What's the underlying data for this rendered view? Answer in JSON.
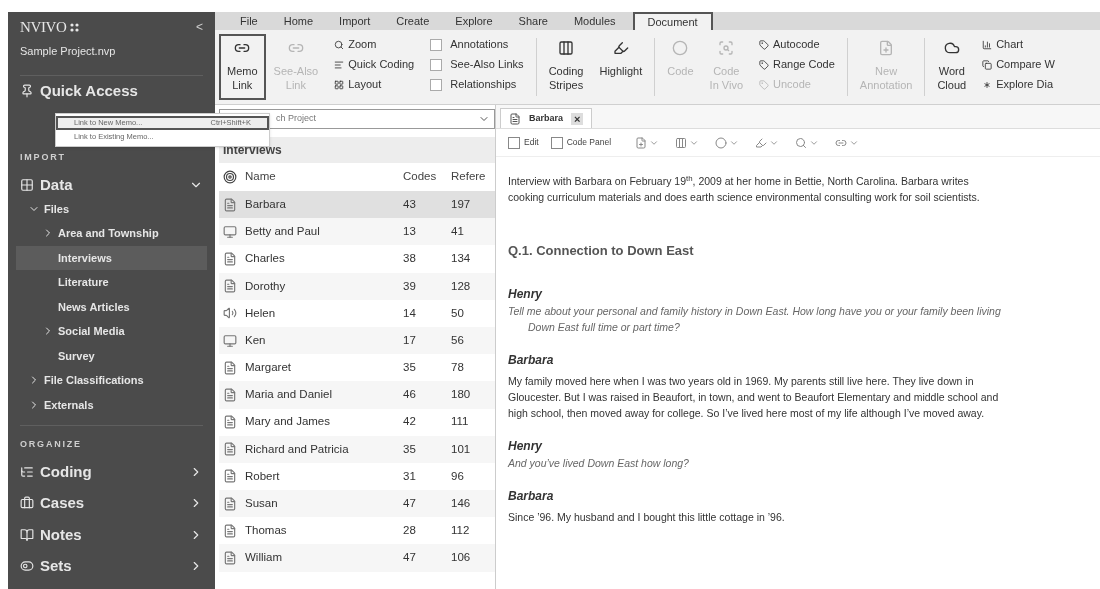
{
  "sidebar": {
    "logo": "NVIVO",
    "collapse": "<",
    "project": "Sample Project.nvp",
    "quick_access": "Quick Access",
    "sections": [
      {
        "title": "IMPORT",
        "items": [
          {
            "label": "Data",
            "expanded": true,
            "children": [
              {
                "label": "Files",
                "expanded": true,
                "children": [
                  {
                    "label": "Area and Township",
                    "expandable": true,
                    "selected": false
                  },
                  {
                    "label": "Interviews",
                    "expandable": false,
                    "selected": true
                  },
                  {
                    "label": "Literature",
                    "expandable": false,
                    "selected": false
                  },
                  {
                    "label": "News Articles",
                    "expandable": false,
                    "selected": false
                  },
                  {
                    "label": "Social Media",
                    "expandable": true,
                    "selected": false
                  },
                  {
                    "label": "Survey",
                    "expandable": false,
                    "selected": false
                  }
                ]
              },
              {
                "label": "File Classifications",
                "expanded": false
              },
              {
                "label": "Externals",
                "expanded": false
              }
            ]
          }
        ]
      },
      {
        "title": "ORGANIZE",
        "items": [
          {
            "label": "Coding",
            "expanded": false
          },
          {
            "label": "Cases",
            "expanded": false
          },
          {
            "label": "Notes",
            "expanded": false
          },
          {
            "label": "Sets",
            "expanded": false
          }
        ]
      }
    ]
  },
  "ribbon": {
    "tabs": [
      {
        "label": "File",
        "selected": false
      },
      {
        "label": "Home",
        "selected": false
      },
      {
        "label": "Import",
        "selected": false
      },
      {
        "label": "Create",
        "selected": false
      },
      {
        "label": "Explore",
        "selected": false
      },
      {
        "label": "Share",
        "selected": false
      },
      {
        "label": "Modules",
        "selected": false
      },
      {
        "label": "Document",
        "selected": true
      }
    ],
    "groups": [
      {
        "kind": "large",
        "label": "Memo\nLink",
        "disabled": false,
        "selected": true
      },
      {
        "kind": "large",
        "label": "See-Also\nLink",
        "disabled": true,
        "selected": false
      },
      {
        "kind": "stack",
        "items": [
          {
            "label": "Zoom",
            "disabled": false
          },
          {
            "label": "Quick Coding",
            "disabled": false
          },
          {
            "label": "Layout",
            "disabled": false
          }
        ]
      },
      {
        "kind": "checks",
        "items": [
          {
            "label": "Annotations",
            "checked": false
          },
          {
            "label": "See-Also Links",
            "checked": false
          },
          {
            "label": "Relationships",
            "checked": false
          }
        ]
      },
      {
        "kind": "large",
        "label": "Coding\nStripes",
        "disabled": false,
        "selected": false
      },
      {
        "kind": "large",
        "label": "Highlight",
        "disabled": false,
        "selected": false
      },
      {
        "kind": "large",
        "label": "Code",
        "disabled": true,
        "selected": false
      },
      {
        "kind": "large",
        "label": "Code\nIn Vivo",
        "disabled": true,
        "selected": false
      },
      {
        "kind": "stack",
        "items": [
          {
            "label": "Autocode",
            "disabled": false
          },
          {
            "label": "Range Code",
            "disabled": false
          },
          {
            "label": "Uncode",
            "disabled": true
          }
        ]
      },
      {
        "kind": "large",
        "label": "New\nAnnotation",
        "disabled": true,
        "selected": false
      },
      {
        "kind": "large",
        "label": "Word\nCloud",
        "disabled": false,
        "selected": false
      },
      {
        "kind": "stack",
        "items": [
          {
            "label": "Chart",
            "disabled": false
          },
          {
            "label": "Compare W",
            "disabled": false
          },
          {
            "label": "Explore Dia",
            "disabled": false
          }
        ]
      }
    ]
  },
  "menu": {
    "items": [
      {
        "label": "Link to New Memo...",
        "shortcut": "Ctrl+Shift+K",
        "selected": true
      },
      {
        "label": "Link to Existing Memo...",
        "selected": false
      }
    ]
  },
  "list": {
    "search": {
      "placeholder": "ch Project"
    },
    "title": "Interviews",
    "columns": [
      "Name",
      "Codes",
      "Refere"
    ],
    "rows": [
      {
        "kind": "document",
        "name": "Barbara",
        "codes": "43",
        "refs": "197",
        "selected": true
      },
      {
        "kind": "video",
        "name": "Betty and Paul",
        "codes": "13",
        "refs": "41",
        "selected": false
      },
      {
        "kind": "document",
        "name": "Charles",
        "codes": "38",
        "refs": "134",
        "selected": false
      },
      {
        "kind": "document",
        "name": "Dorothy",
        "codes": "39",
        "refs": "128",
        "selected": false
      },
      {
        "kind": "audio",
        "name": "Helen",
        "codes": "14",
        "refs": "50",
        "selected": false
      },
      {
        "kind": "video",
        "name": "Ken",
        "codes": "17",
        "refs": "56",
        "selected": false
      },
      {
        "kind": "document",
        "name": "Margaret",
        "codes": "35",
        "refs": "78",
        "selected": false
      },
      {
        "kind": "document",
        "name": "Maria and Daniel",
        "codes": "46",
        "refs": "180",
        "selected": false
      },
      {
        "kind": "document",
        "name": "Mary and James",
        "codes": "42",
        "refs": "111",
        "selected": false
      },
      {
        "kind": "document",
        "name": "Richard and Patricia",
        "codes": "35",
        "refs": "101",
        "selected": false
      },
      {
        "kind": "document",
        "name": "Robert",
        "codes": "31",
        "refs": "96",
        "selected": false
      },
      {
        "kind": "document",
        "name": "Susan",
        "codes": "47",
        "refs": "146",
        "selected": false
      },
      {
        "kind": "document",
        "name": "Thomas",
        "codes": "28",
        "refs": "112",
        "selected": false
      },
      {
        "kind": "document",
        "name": "William",
        "codes": "47",
        "refs": "106",
        "selected": false
      }
    ]
  },
  "document": {
    "tab": {
      "label": "Barbara",
      "close": "×"
    },
    "toolbar": {
      "checks": [
        {
          "label": "Edit",
          "checked": false
        },
        {
          "label": "Code Panel",
          "checked": false
        }
      ]
    },
    "paragraphs": [
      {
        "kind": "text",
        "text": "Interview with Barbara on February 19$^{th}$, 2009 at her home in Bettie, North Carolina. Barbara writes cooking curriculum materials and does earth science environmental consulting work for soil scientists."
      },
      {
        "kind": "heading",
        "text": "Q.1. Connection to Down East"
      },
      {
        "kind": "speaker",
        "text": "Henry"
      },
      {
        "kind": "question",
        "text": "Tell me about your personal and family history in Down East. How long have you or your family been living Down East full time or part time?"
      },
      {
        "kind": "speaker",
        "text": "Barbara"
      },
      {
        "kind": "text",
        "text": "My family moved here when I was two years old in 1969. My parents still live here. They live down in Gloucester. But I was raised in Beaufort, in town, and went to Beaufort Elementary and middle school and high school, then moved away for college. So I’ve lived here most of my life although I’ve moved away."
      },
      {
        "kind": "speaker",
        "text": "Henry"
      },
      {
        "kind": "question",
        "text": "And you’ve lived Down East how long?"
      },
      {
        "kind": "speaker",
        "text": "Barbara"
      },
      {
        "kind": "text",
        "text": "Since ’96. My husband and I bought this little cottage in ’96."
      }
    ]
  }
}
